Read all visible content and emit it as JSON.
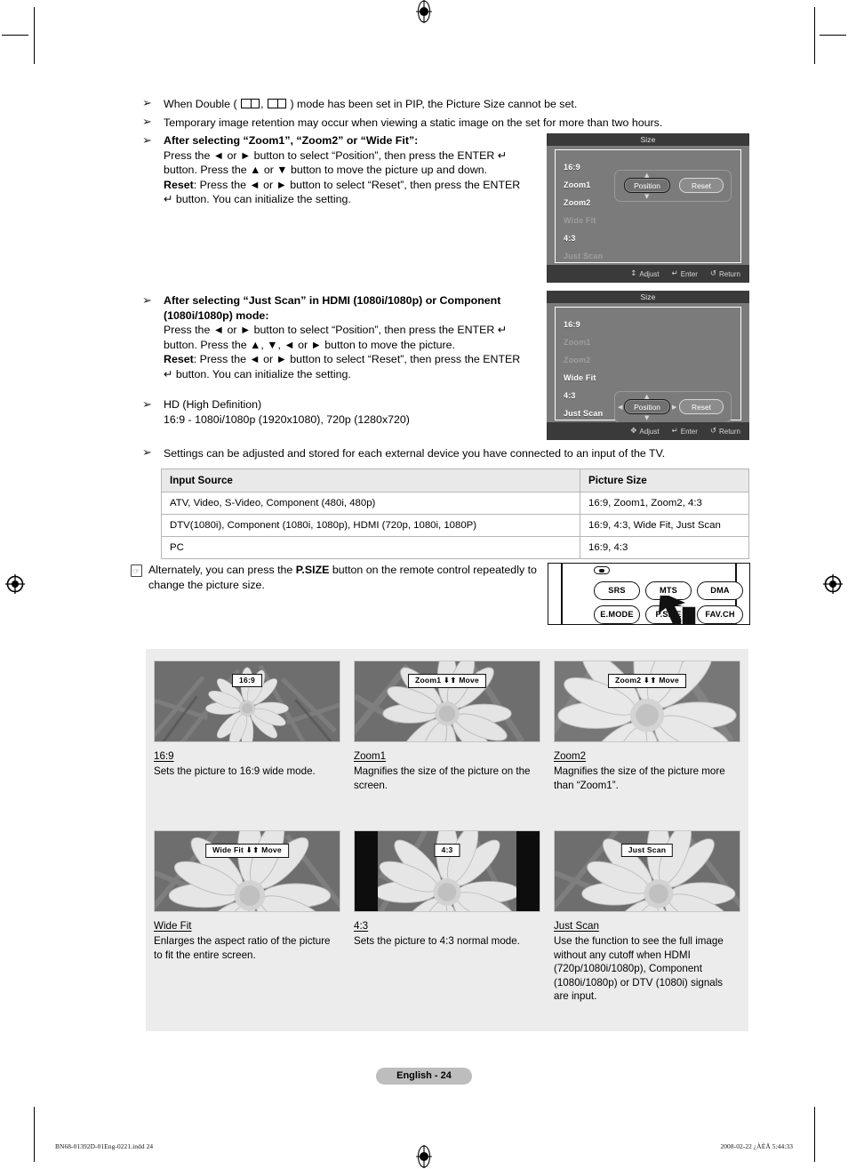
{
  "bullets": [
    {
      "id": "double-pip",
      "symbol": "➢",
      "parts": [
        {
          "t": "When Double ( ",
          "b": false
        },
        {
          "t": "__PIP__",
          "b": false
        },
        {
          "t": " , ",
          "b": false
        },
        {
          "t": "__PIP__",
          "b": false
        },
        {
          "t": " ) mode has been set in PIP, the Picture Size cannot be set.",
          "b": false
        }
      ],
      "text": "When Double (  ,  ) mode has been set in PIP, the Picture Size cannot be set."
    },
    {
      "id": "image-retention",
      "symbol": "➢",
      "text": "Temporary image retention may occur when viewing a static image on the set for more than two hours."
    },
    {
      "id": "after-zoom",
      "symbol": "➢",
      "heading": "After selecting “Zoom1”, “Zoom2” or “Wide Fit”:",
      "line1": "Press the ◄ or ► button to select “Position”, then press the ENTER ↵",
      "line2": "button. Press the ▲ or ▼ button to move the picture up and down.",
      "reset_label": "Reset",
      "line3": ": Press the ◄ or ► button to select “Reset”, then press the ENTER",
      "line4": "↵ button. You can initialize the setting."
    },
    {
      "id": "after-just-scan",
      "symbol": "➢",
      "heading1": "After selecting “Just Scan” in HDMI (1080i/1080p) or Component",
      "heading2": "(1080i/1080p) mode:",
      "line1": "Press the ◄ or ► button to select “Position”, then press the ENTER ↵",
      "line2": "button. Press the ▲, ▼, ◄ or ► button to move the picture.",
      "reset_label": "Reset",
      "line3": ": Press the ◄ or ► button to select “Reset”, then press the ENTER",
      "line4": "↵ button. You can initialize the setting."
    },
    {
      "id": "hd-definition",
      "symbol": "➢",
      "line1": "HD (High Definition)",
      "line2": "16:9 - 1080i/1080p (1920x1080), 720p (1280x720)"
    },
    {
      "id": "settings-stored",
      "symbol": "➢",
      "text": "Settings can be adjusted and stored for each external device you have connected to an input of the TV."
    }
  ],
  "osd_menus": [
    {
      "id": "size-menu-zoom",
      "title": "Size",
      "items": [
        {
          "label": "16:9",
          "dim": false
        },
        {
          "label": "Zoom1",
          "dim": false
        },
        {
          "label": "Zoom2",
          "dim": false
        },
        {
          "label": "Wide Fit",
          "dim": true
        },
        {
          "label": "4:3",
          "dim": false
        },
        {
          "label": "Just Scan",
          "dim": true
        }
      ],
      "position_label": "Position",
      "reset_label": "Reset",
      "footer": [
        {
          "icon": "↕",
          "label": "Adjust"
        },
        {
          "icon": "↵",
          "label": "Enter"
        },
        {
          "icon": "↺",
          "label": "Return"
        }
      ]
    },
    {
      "id": "size-menu-just-scan",
      "title": "Size",
      "items": [
        {
          "label": "16:9",
          "dim": false
        },
        {
          "label": "Zoom1",
          "dim": true
        },
        {
          "label": "Zoom2",
          "dim": true
        },
        {
          "label": "Wide Fit",
          "dim": false
        },
        {
          "label": "4:3",
          "dim": false
        },
        {
          "label": "Just Scan",
          "dim": false
        }
      ],
      "position_label": "Position",
      "reset_label": "Reset",
      "footer": [
        {
          "icon": "✥",
          "label": "Adjust"
        },
        {
          "icon": "↵",
          "label": "Enter"
        },
        {
          "icon": "↺",
          "label": "Return"
        }
      ]
    }
  ],
  "table": {
    "headers": [
      "Input Source",
      "Picture Size"
    ],
    "rows": [
      [
        "ATV, Video, S-Video, Component (480i, 480p)",
        "16:9, Zoom1, Zoom2, 4:3"
      ],
      [
        "DTV(1080i), Component (1080i, 1080p), HDMI (720p, 1080i, 1080P)",
        "16:9, 4:3, Wide Fit, Just Scan"
      ],
      [
        "PC",
        "16:9, 4:3"
      ]
    ]
  },
  "note": {
    "icon": "☞",
    "line1_a": "Alternately, you can press the ",
    "line1_b": "P.SIZE",
    "line1_c": " button on the remote control repeatedly",
    "line2": "to change the picture size."
  },
  "remote": {
    "buttons": [
      "SRS",
      "MTS",
      "DMA",
      "E.MODE",
      "P.SIZE",
      "FAV.CH"
    ]
  },
  "gallery": [
    {
      "id": "mode-16-9",
      "tag": "16:9",
      "tag_move": "",
      "title": "16:9",
      "desc": "Sets the picture to 16:9 wide mode.",
      "pillarbox": false
    },
    {
      "id": "mode-zoom1",
      "tag": "Zoom1",
      "tag_move": "Move",
      "title": "Zoom1",
      "desc": "Magnifies the size of the picture on the screen.",
      "pillarbox": false
    },
    {
      "id": "mode-zoom2",
      "tag": "Zoom2",
      "tag_move": "Move",
      "title": "Zoom2",
      "desc": "Magnifies the size of the picture more than “Zoom1”.",
      "pillarbox": false
    },
    {
      "id": "mode-wide-fit",
      "tag": "Wide Fit",
      "tag_move": "Move",
      "title": "Wide Fit",
      "desc": "Enlarges the aspect ratio of the picture to fit the entire screen.",
      "pillarbox": false
    },
    {
      "id": "mode-4-3",
      "tag": "4:3",
      "tag_move": "",
      "title": "4:3",
      "desc": "Sets the picture to 4:3 normal mode.",
      "pillarbox": true
    },
    {
      "id": "mode-just-scan",
      "tag": "Just Scan",
      "tag_move": "",
      "title": "Just Scan",
      "desc": "Use the function to see the full image without any cutoff when HDMI (720p/1080i/1080p), Component (1080i/1080p) or DTV (1080i) signals are input.",
      "pillarbox": false
    }
  ],
  "footer": {
    "page_label": "English - 24",
    "print_left": "BN68-01392D-01Eng-0221.indd   24",
    "print_right": "2008-02-22   ¿ÀÈÄ 5:44:33"
  }
}
